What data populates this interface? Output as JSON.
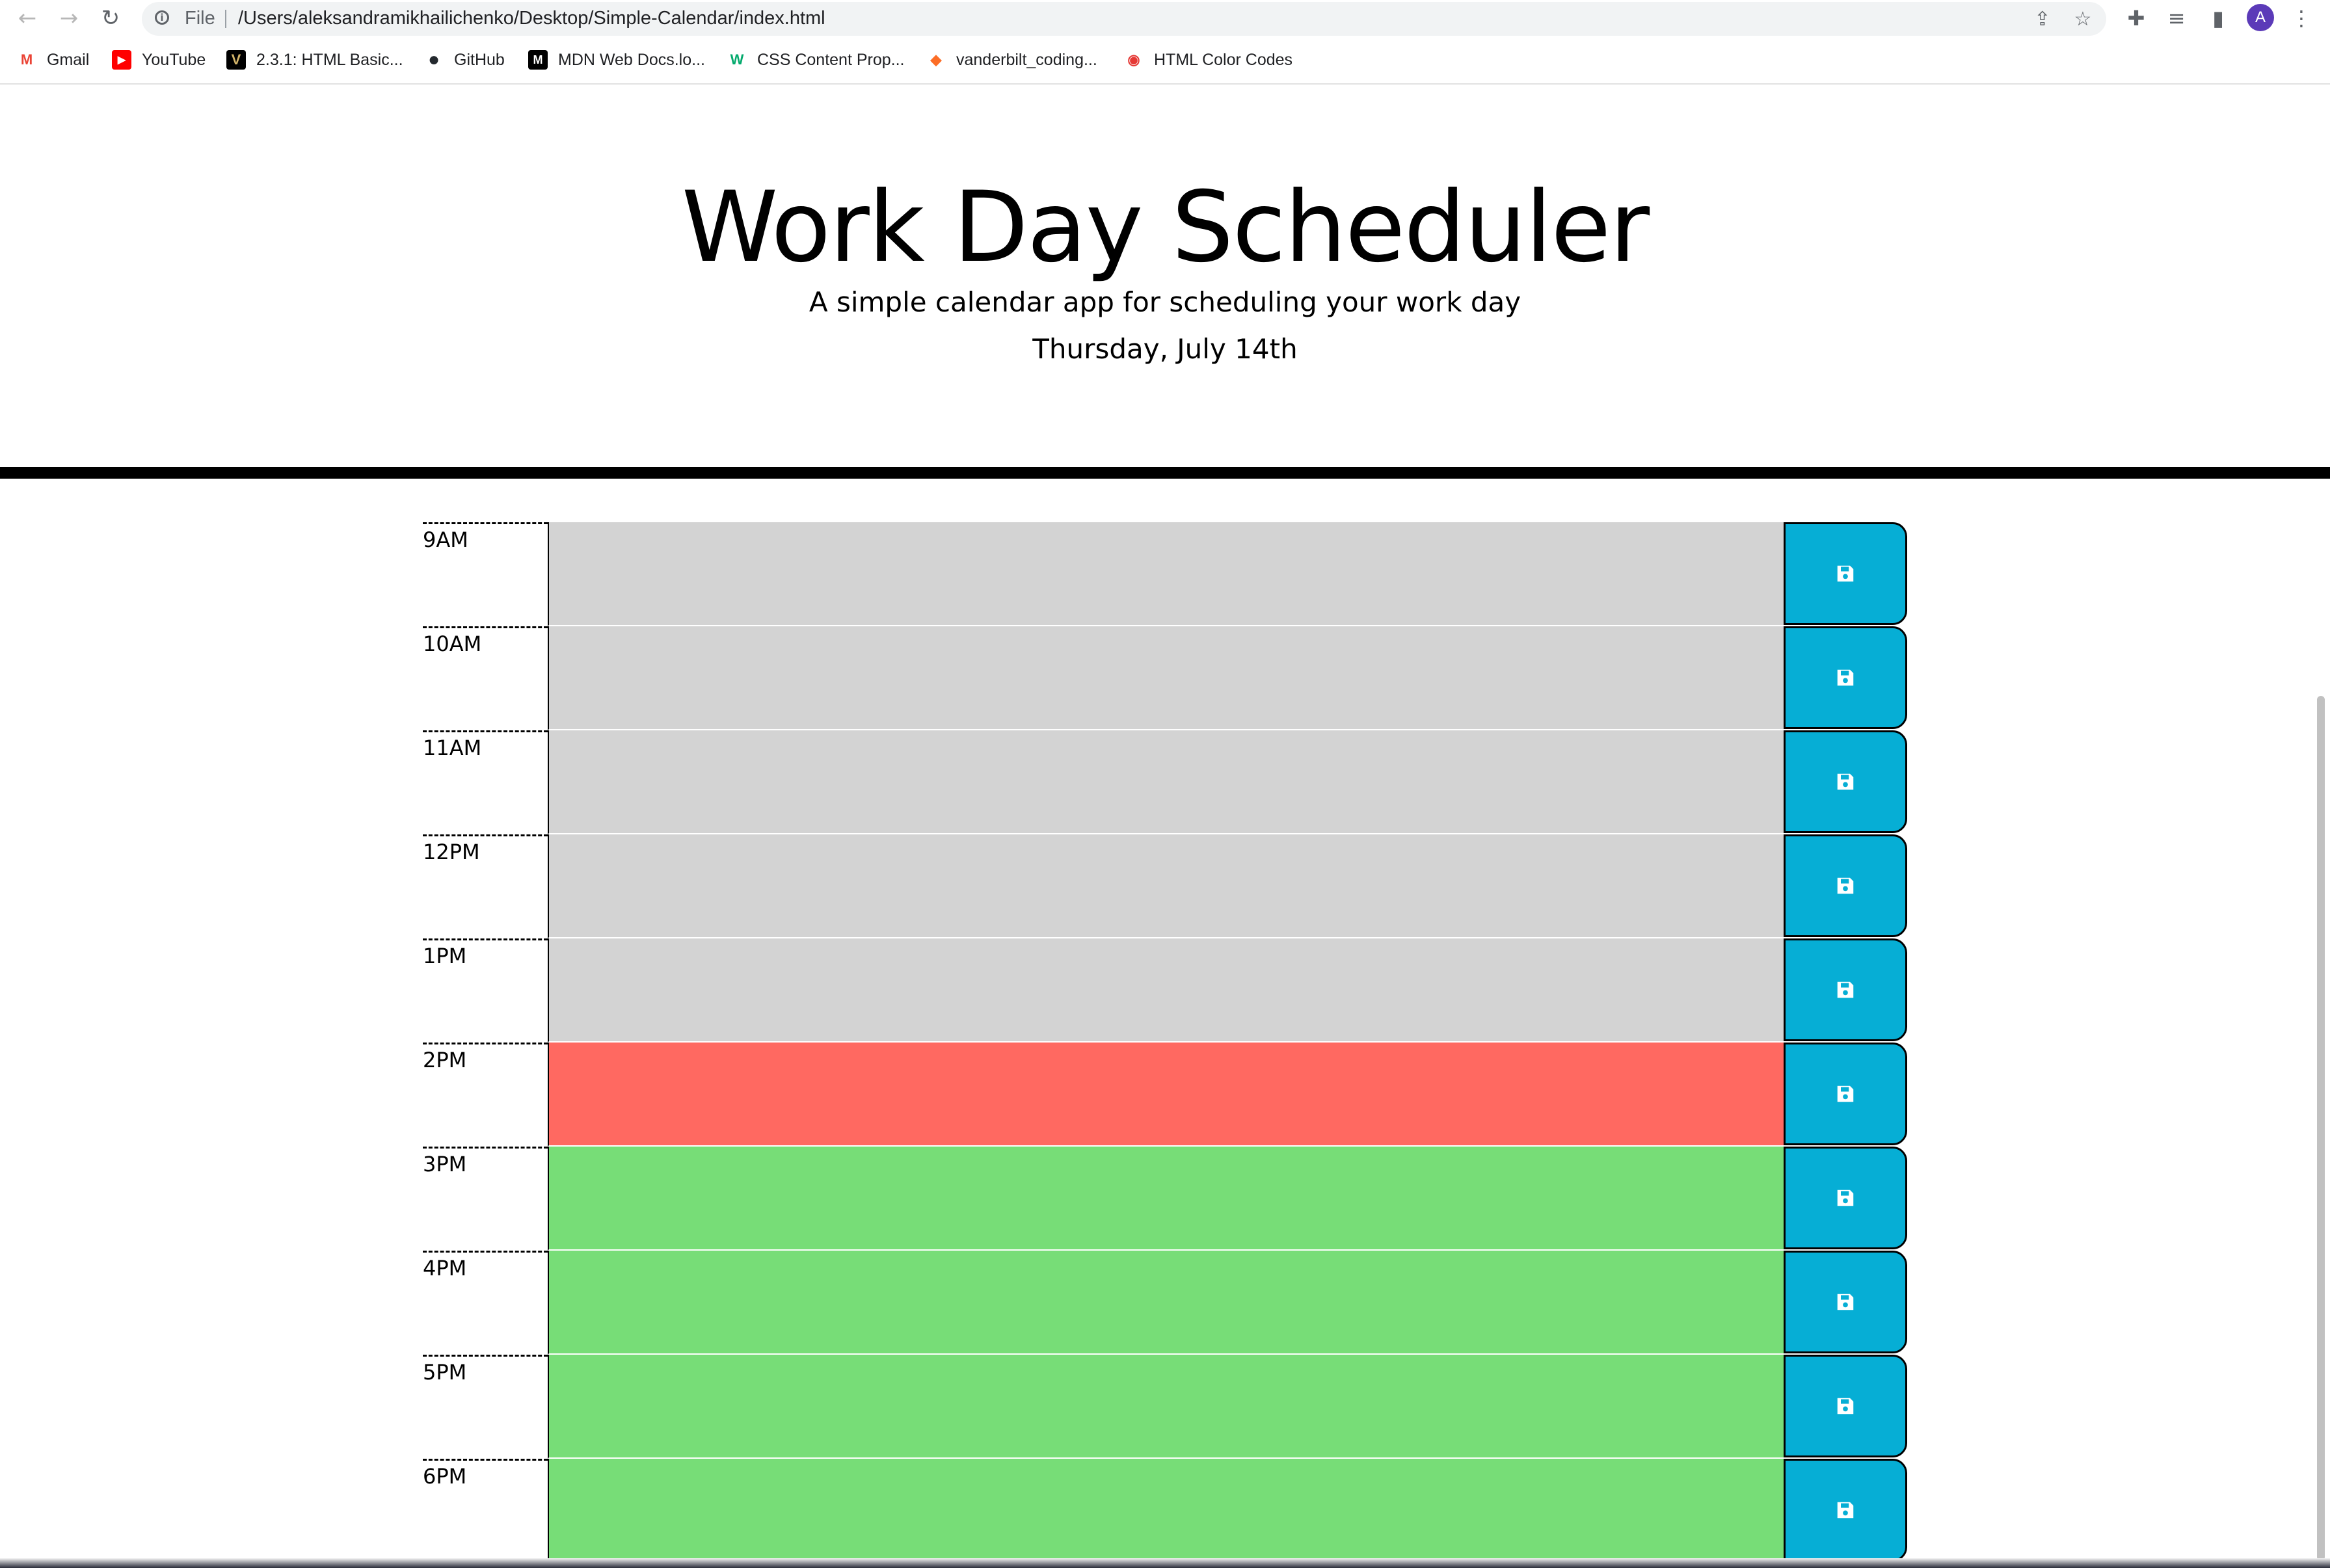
{
  "browser": {
    "file_label": "File",
    "url": "/Users/aleksandramikhailichenko/Desktop/Simple-Calendar/index.html",
    "avatar_letter": "A",
    "bookmarks": [
      {
        "label": "Gmail",
        "icon": "gmail-icon",
        "glyph": "M",
        "color": "#ea4335"
      },
      {
        "label": "YouTube",
        "icon": "youtube-icon",
        "glyph": "▶",
        "color": "#ff0000"
      },
      {
        "label": "2.3.1: HTML Basic...",
        "icon": "vanderbilt-icon",
        "glyph": "V",
        "color": "#000000"
      },
      {
        "label": "GitHub",
        "icon": "github-icon",
        "glyph": "●",
        "color": "#24292e"
      },
      {
        "label": "MDN Web Docs.lo...",
        "icon": "mdn-icon",
        "glyph": "M",
        "color": "#000000"
      },
      {
        "label": "CSS Content Prop...",
        "icon": "w3schools-icon",
        "glyph": "W",
        "color": "#04aa6d"
      },
      {
        "label": "vanderbilt_coding...",
        "icon": "gitlab-icon",
        "glyph": "◆",
        "color": "#fc6d26"
      },
      {
        "label": "HTML Color Codes",
        "icon": "color-codes-icon",
        "glyph": "◉",
        "color": "#e53935"
      }
    ]
  },
  "header": {
    "title": "Work Day Scheduler",
    "lead": "A simple calendar app for scheduling your work day",
    "current_day": "Thursday, July 14th"
  },
  "colors": {
    "past": "#d3d3d3",
    "present": "#ff6961",
    "future": "#77dd77",
    "save_button": "#06aed5"
  },
  "timeblocks": [
    {
      "hour": "9AM",
      "state": "past",
      "text": ""
    },
    {
      "hour": "10AM",
      "state": "past",
      "text": ""
    },
    {
      "hour": "11AM",
      "state": "past",
      "text": ""
    },
    {
      "hour": "12PM",
      "state": "past",
      "text": ""
    },
    {
      "hour": "1PM",
      "state": "past",
      "text": ""
    },
    {
      "hour": "2PM",
      "state": "present",
      "text": ""
    },
    {
      "hour": "3PM",
      "state": "future",
      "text": ""
    },
    {
      "hour": "4PM",
      "state": "future",
      "text": ""
    },
    {
      "hour": "5PM",
      "state": "future",
      "text": ""
    },
    {
      "hour": "6PM",
      "state": "future",
      "text": ""
    }
  ]
}
